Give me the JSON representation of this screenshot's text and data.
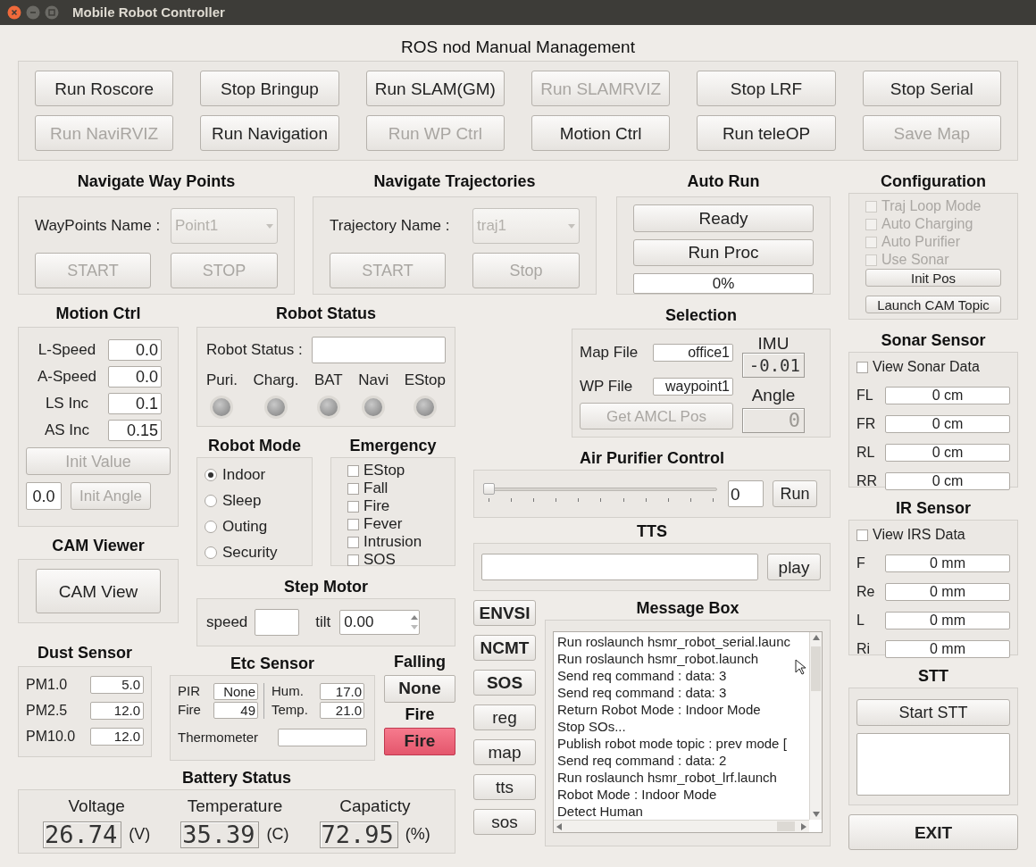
{
  "window": {
    "title": "Mobile Robot Controller"
  },
  "ros_manual": {
    "title": "ROS nod Manual Management",
    "buttons": [
      {
        "label": "Run Roscore",
        "disabled": false
      },
      {
        "label": "Stop Bringup",
        "disabled": false
      },
      {
        "label": "Run SLAM(GM)",
        "disabled": false
      },
      {
        "label": "Run SLAMRVIZ",
        "disabled": true
      },
      {
        "label": "Stop LRF",
        "disabled": false
      },
      {
        "label": "Stop Serial",
        "disabled": false
      },
      {
        "label": "Run NaviRVIZ",
        "disabled": true
      },
      {
        "label": "Run Navigation",
        "disabled": false
      },
      {
        "label": "Run WP Ctrl",
        "disabled": true
      },
      {
        "label": "Motion Ctrl",
        "disabled": false
      },
      {
        "label": "Run teleOP",
        "disabled": false
      },
      {
        "label": "Save Map",
        "disabled": true
      }
    ]
  },
  "waypoints": {
    "title": "Navigate Way Points",
    "name_label": "WayPoints Name :",
    "value": "Point1",
    "disabled": true,
    "buttons": [
      {
        "label": "START",
        "disabled": true
      },
      {
        "label": "STOP",
        "disabled": true
      }
    ]
  },
  "trajectories": {
    "title": "Navigate Trajectories",
    "name_label": "Trajectory Name :",
    "value": "traj1",
    "disabled": true,
    "buttons": [
      {
        "label": "START",
        "disabled": true
      },
      {
        "label": "Stop",
        "disabled": true
      }
    ]
  },
  "auto_run": {
    "title": "Auto Run",
    "buttons": [
      "Ready",
      "Run Proc"
    ],
    "progress": {
      "level": 0,
      "text": "0%"
    }
  },
  "configuration": {
    "title": "Configuration",
    "options": [
      {
        "label": "Traj Loop Mode",
        "checked": false,
        "disabled": true
      },
      {
        "label": "Auto Charging",
        "checked": false,
        "disabled": true
      },
      {
        "label": "Auto Purifier",
        "checked": false,
        "disabled": true
      },
      {
        "label": "Use Sonar",
        "checked": false,
        "disabled": true
      }
    ],
    "buttons": [
      "Init Pos",
      "Launch CAM Topic"
    ]
  },
  "motion_ctrl": {
    "title": "Motion Ctrl",
    "fields": [
      {
        "label": "L-Speed",
        "value": "0.0"
      },
      {
        "label": "A-Speed",
        "value": "0.0"
      },
      {
        "label": "LS Inc",
        "value": "0.1"
      },
      {
        "label": "AS Inc",
        "value": "0.15"
      }
    ],
    "init_value": {
      "label": "Init Value",
      "disabled": true
    },
    "angle_value": "0.0",
    "init_angle": {
      "label": "Init Angle",
      "disabled": true
    }
  },
  "robot_status": {
    "title": "Robot Status",
    "status_label": "Robot Status :",
    "leds": [
      {
        "label": "Puri.",
        "on": false
      },
      {
        "label": "Charg.",
        "on": false
      },
      {
        "label": "BAT",
        "on": false
      },
      {
        "label": "Navi",
        "on": false
      },
      {
        "label": "EStop",
        "on": false
      }
    ]
  },
  "selection": {
    "title": "Selection",
    "map_label": "Map File",
    "map_value": "office1",
    "wp_label": "WP File",
    "wp_value": "waypoint1",
    "amcl_button": {
      "label": "Get AMCL Pos",
      "disabled": true
    },
    "imu_label": "IMU",
    "imu_value": "-0.01",
    "angle_label": "Angle",
    "angle_value": "0",
    "angle_disabled": true
  },
  "sonar": {
    "title": "Sonar Sensor",
    "view": {
      "label": "View Sonar Data",
      "checked": false
    },
    "readings": [
      {
        "label": "FL",
        "value": "0 cm"
      },
      {
        "label": "FR",
        "value": "0 cm"
      },
      {
        "label": "RL",
        "value": "0 cm"
      },
      {
        "label": "RR",
        "value": "0 cm"
      }
    ]
  },
  "ir": {
    "title": "IR Sensor",
    "view": {
      "label": "View IRS  Data",
      "checked": false
    },
    "readings": [
      {
        "label": "F",
        "value": "0 mm"
      },
      {
        "label": "Re",
        "value": "0 mm"
      },
      {
        "label": "L",
        "value": "0 mm"
      },
      {
        "label": "Ri",
        "value": "0 mm"
      }
    ]
  },
  "robot_mode": {
    "title": "Robot Mode",
    "options": [
      {
        "label": "Indoor",
        "selected": true
      },
      {
        "label": "Sleep",
        "selected": false
      },
      {
        "label": "Outing",
        "selected": false
      },
      {
        "label": "Security",
        "selected": false
      }
    ]
  },
  "emergency": {
    "title": "Emergency",
    "options": [
      {
        "label": "EStop",
        "checked": false
      },
      {
        "label": "Fall",
        "checked": false
      },
      {
        "label": "Fire",
        "checked": false
      },
      {
        "label": "Fever",
        "checked": false
      },
      {
        "label": "Intrusion",
        "checked": false
      },
      {
        "label": "SOS",
        "checked": false
      }
    ]
  },
  "cam_viewer": {
    "title": "CAM Viewer",
    "button": "CAM View"
  },
  "air_purifier": {
    "title": "Air Purifier Control",
    "slider": {
      "level": 0
    },
    "value": "0",
    "button": "Run"
  },
  "tts": {
    "title": "TTS",
    "button": "play"
  },
  "step_motor": {
    "title": "Step Motor",
    "speed_label": "speed",
    "tilt_label": "tilt",
    "tilt_value": "0.00"
  },
  "dust": {
    "title": "Dust Sensor",
    "readings": [
      {
        "label": "PM1.0",
        "value": "5.0"
      },
      {
        "label": "PM2.5",
        "value": "12.0"
      },
      {
        "label": "PM10.0",
        "value": "12.0"
      }
    ]
  },
  "etc": {
    "title": "Etc Sensor",
    "left": [
      {
        "label": "PIR",
        "value": "None"
      },
      {
        "label": "Fire",
        "value": "49"
      }
    ],
    "right": [
      {
        "label": "Hum.",
        "value": "17.0"
      },
      {
        "label": "Temp.",
        "value": "21.0"
      }
    ],
    "thermometer_label": "Thermometer"
  },
  "alarms": [
    {
      "title": "Falling",
      "status": "None",
      "alarm": false
    },
    {
      "title": "Fire",
      "status": "Fire",
      "alarm": true
    }
  ],
  "side_buttons": [
    {
      "label": "ENVSI",
      "bold": true
    },
    {
      "label": "NCMT",
      "bold": true
    },
    {
      "label": "SOS",
      "bold": true
    },
    {
      "label": "reg",
      "bold": false
    },
    {
      "label": "map",
      "bold": false
    },
    {
      "label": "tts",
      "bold": false
    },
    {
      "label": "sos",
      "bold": false
    }
  ],
  "message_box": {
    "title": "Message Box",
    "lines": [
      "Run roslaunch hsmr_robot_serial.launc",
      "Run roslaunch hsmr_robot.launch",
      "Send req command : data: 3",
      "Send req command : data: 3",
      "Return Robot Mode : Indoor Mode",
      "Stop SOs...",
      "Publish robot mode topic : prev mode [",
      "Send req command : data: 2",
      "Run roslaunch hsmr_robot_lrf.launch",
      "Robot Mode : Indoor Mode",
      "Detect Human"
    ]
  },
  "battery": {
    "title": "Battery Status",
    "items": [
      {
        "label": "Voltage",
        "value": "26.74",
        "unit": "(V)"
      },
      {
        "label": "Temperature",
        "value": "35.39",
        "unit": "(C)"
      },
      {
        "label": "Capaticty",
        "value": "72.95",
        "unit": "(%)"
      }
    ]
  },
  "stt": {
    "title": "STT",
    "button": "Start STT"
  },
  "exit": {
    "label": "EXIT"
  }
}
